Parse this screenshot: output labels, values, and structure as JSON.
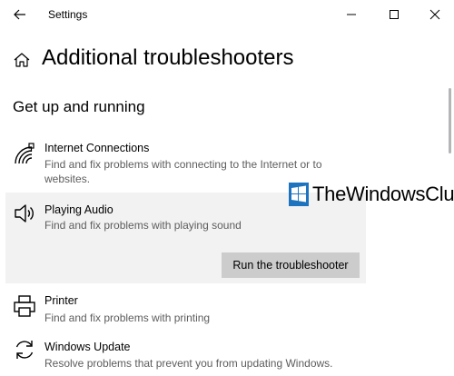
{
  "window": {
    "title": "Settings",
    "back_icon": "back-arrow-icon",
    "minimize_icon": "minimize-icon",
    "maximize_icon": "maximize-icon",
    "close_icon": "close-icon"
  },
  "page": {
    "home_icon": "home-icon",
    "title": "Additional troubleshooters"
  },
  "section": {
    "title": "Get up and running"
  },
  "items": [
    {
      "icon": "wifi-network-icon",
      "name": "Internet Connections",
      "description": "Find and fix problems with connecting to the Internet or to websites.",
      "selected": false
    },
    {
      "icon": "speaker-icon",
      "name": "Playing Audio",
      "description": "Find and fix problems with playing sound",
      "selected": true,
      "button_label": "Run the troubleshooter"
    },
    {
      "icon": "printer-icon",
      "name": "Printer",
      "description": "Find and fix problems with printing",
      "selected": false
    },
    {
      "icon": "sync-icon",
      "name": "Windows Update",
      "description": "Resolve problems that prevent you from updating Windows.",
      "selected": false
    }
  ],
  "watermark": {
    "text": "TheWindowsClub",
    "logo_color": "#1e73be"
  },
  "colors": {
    "selected_background": "#f2f2f2",
    "button_background": "#cccccc",
    "description_text": "#5d5d5d"
  }
}
